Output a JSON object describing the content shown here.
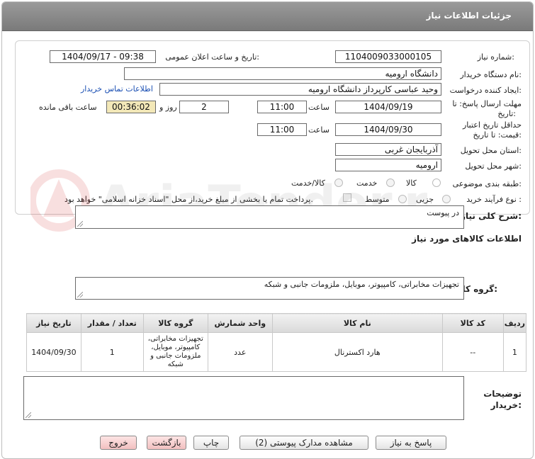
{
  "header": {
    "title": "جزئیات اطلاعات نیاز"
  },
  "form": {
    "need_number_label": "شماره نیاز:",
    "need_number": "1104009033000105",
    "announce_label": "تاریخ و ساعت اعلان عمومی:",
    "announce_value": "1404/09/17 - 09:38",
    "buyer_org_label": "نام دستگاه خریدار:",
    "buyer_org": "دانشگاه ارومیه",
    "creator_label": "ایجاد کننده درخواست:",
    "creator": "وحید عباسی کارپرداز دانشگاه ارومیه",
    "contact_link": "اطلاعات تماس خریدار",
    "deadline_label_1": "مهلت ارسال پاسخ: تا",
    "deadline_label_2": "تاریخ:",
    "deadline_date": "1404/09/19",
    "hour_label": "ساعت",
    "deadline_time": "11:00",
    "days_value": "2",
    "days_label": "روز و",
    "remaining_time": "00:36:02",
    "remaining_label": "ساعت باقی مانده",
    "validity_label_1": "حداقل تاریخ اعتبار",
    "validity_label_2": "قیمت: تا تاریخ:",
    "validity_date": "1404/09/30",
    "validity_time": "11:00",
    "province_label": "استان محل تحویل:",
    "province": "آذربایجان غربی",
    "city_label": "شهر محل تحویل:",
    "city": "ارومیه",
    "category_label": "طبقه بندی موضوعی:",
    "category_options": [
      "کالا",
      "خدمت",
      "کالا/خدمت"
    ],
    "process_label": "نوع فرآیند خرید :",
    "process_options": [
      "جزیی",
      "متوسط"
    ],
    "payment_note": "پرداخت تمام یا بخشی از مبلغ خرید،از محل \"اسناد خزانه اسلامی\" خواهد بود."
  },
  "description": {
    "label": "شرح کلی نیاز:",
    "value": "در پیوست"
  },
  "goods_info": {
    "heading": "اطلاعات کالاهای مورد نیاز",
    "group_label": "گروه کالا:",
    "group_value": "تجهیزات مخابراتی، کامپیوتر، موبایل، ملزومات جانبی و شبکه"
  },
  "table": {
    "headers": [
      "ردیف",
      "کد کالا",
      "نام کالا",
      "واحد شمارش",
      "گروه کالا",
      "تعداد / مقدار",
      "تاریخ نیاز"
    ],
    "rows": [
      [
        "1",
        "--",
        "هارد اکسترنال",
        "عدد",
        "تجهیزات مخابراتی، کامپیوتر، موبایل، ملزومات جانبی و شبکه",
        "1",
        "1404/09/30"
      ]
    ]
  },
  "buyer_notes": {
    "label_1": "توضیحات",
    "label_2": "خریدار:",
    "value": ""
  },
  "buttons": {
    "reply": "پاسخ به نیاز",
    "attachments": "مشاهده مدارک پیوستی (2)",
    "print": "چاپ",
    "back": "بازگشت",
    "exit": "خروج"
  },
  "watermark": {
    "text": "AriaTender.neT"
  },
  "colors": {
    "titlebar": "#8a8a8a",
    "remaining_bg": "#f3e8b8",
    "link": "#1a4fb3",
    "exit_bg": "#f2c0c0"
  }
}
